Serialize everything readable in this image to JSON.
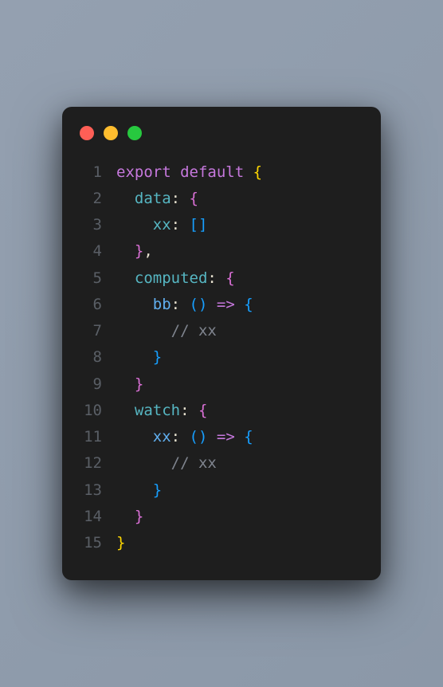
{
  "window": {
    "dots": [
      "red",
      "yellow",
      "green"
    ]
  },
  "code": {
    "lines": [
      {
        "n": "1",
        "tokens": [
          [
            "kw-export",
            "export"
          ],
          [
            "punct",
            " "
          ],
          [
            "kw-default",
            "default"
          ],
          [
            "punct",
            " "
          ],
          [
            "bracket-yellow",
            "{"
          ]
        ]
      },
      {
        "n": "2",
        "tokens": [
          [
            "punct",
            "  "
          ],
          [
            "prop",
            "data"
          ],
          [
            "punct",
            ": "
          ],
          [
            "bracket-pink",
            "{"
          ]
        ]
      },
      {
        "n": "3",
        "tokens": [
          [
            "punct",
            "    "
          ],
          [
            "prop",
            "xx"
          ],
          [
            "punct",
            ": "
          ],
          [
            "bracket-blue",
            "["
          ],
          [
            "bracket-blue",
            "]"
          ]
        ]
      },
      {
        "n": "4",
        "tokens": [
          [
            "punct",
            "  "
          ],
          [
            "bracket-pink",
            "}"
          ],
          [
            "punct",
            ","
          ]
        ]
      },
      {
        "n": "5",
        "tokens": [
          [
            "punct",
            "  "
          ],
          [
            "prop",
            "computed"
          ],
          [
            "punct",
            ": "
          ],
          [
            "bracket-pink",
            "{"
          ]
        ]
      },
      {
        "n": "6",
        "tokens": [
          [
            "punct",
            "    "
          ],
          [
            "blue",
            "bb"
          ],
          [
            "punct",
            ": "
          ],
          [
            "bracket-blue",
            "("
          ],
          [
            "bracket-blue",
            ")"
          ],
          [
            "punct",
            " "
          ],
          [
            "arrow",
            "=>"
          ],
          [
            "punct",
            " "
          ],
          [
            "bracket-blue",
            "{"
          ]
        ]
      },
      {
        "n": "7",
        "tokens": [
          [
            "punct",
            "      "
          ],
          [
            "comment",
            "// xx"
          ]
        ]
      },
      {
        "n": "8",
        "tokens": [
          [
            "punct",
            "    "
          ],
          [
            "bracket-blue",
            "}"
          ]
        ]
      },
      {
        "n": "9",
        "tokens": [
          [
            "punct",
            "  "
          ],
          [
            "bracket-pink",
            "}"
          ]
        ]
      },
      {
        "n": "10",
        "tokens": [
          [
            "punct",
            "  "
          ],
          [
            "prop",
            "watch"
          ],
          [
            "punct",
            ": "
          ],
          [
            "bracket-pink",
            "{"
          ]
        ]
      },
      {
        "n": "11",
        "tokens": [
          [
            "punct",
            "    "
          ],
          [
            "blue",
            "xx"
          ],
          [
            "punct",
            ": "
          ],
          [
            "bracket-blue",
            "("
          ],
          [
            "bracket-blue",
            ")"
          ],
          [
            "punct",
            " "
          ],
          [
            "arrow",
            "=>"
          ],
          [
            "punct",
            " "
          ],
          [
            "bracket-blue",
            "{"
          ]
        ]
      },
      {
        "n": "12",
        "tokens": [
          [
            "punct",
            "      "
          ],
          [
            "comment",
            "// xx"
          ]
        ]
      },
      {
        "n": "13",
        "tokens": [
          [
            "punct",
            "    "
          ],
          [
            "bracket-blue",
            "}"
          ]
        ]
      },
      {
        "n": "14",
        "tokens": [
          [
            "punct",
            "  "
          ],
          [
            "bracket-pink",
            "}"
          ]
        ]
      },
      {
        "n": "15",
        "tokens": [
          [
            "bracket-yellow",
            "}"
          ]
        ]
      }
    ]
  }
}
